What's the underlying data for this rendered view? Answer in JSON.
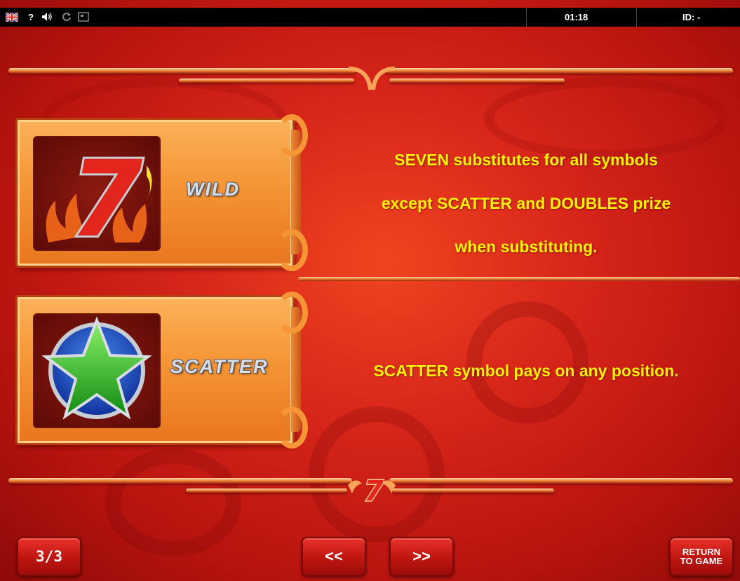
{
  "topbar": {
    "flag_icon": "uk-flag-icon",
    "help_label": "?",
    "sound_icon": "speaker-icon",
    "reload_icon": "reload-icon",
    "fullscreen_icon": "fullscreen-icon",
    "clock": "01:18",
    "id_text": "ID: -"
  },
  "symbols": [
    {
      "label": "WILD",
      "icon": "seven-icon",
      "glyph": "7",
      "description_lines": [
        "SEVEN substitutes for all symbols",
        "except SCATTER and DOUBLES prize",
        "when substituting."
      ]
    },
    {
      "label": "SCATTER",
      "icon": "star-icon",
      "glyph": "★",
      "description_lines": [
        "SCATTER symbol pays on any position."
      ]
    }
  ],
  "navigation": {
    "page_label": "3/3",
    "prev_label": "<<",
    "next_label": ">>",
    "return_line1": "RETURN",
    "return_line2": "TO GAME"
  },
  "colors": {
    "background": "#d8261a",
    "accent_text": "#fff200",
    "panel": "#f59535",
    "button": "#c21712"
  }
}
